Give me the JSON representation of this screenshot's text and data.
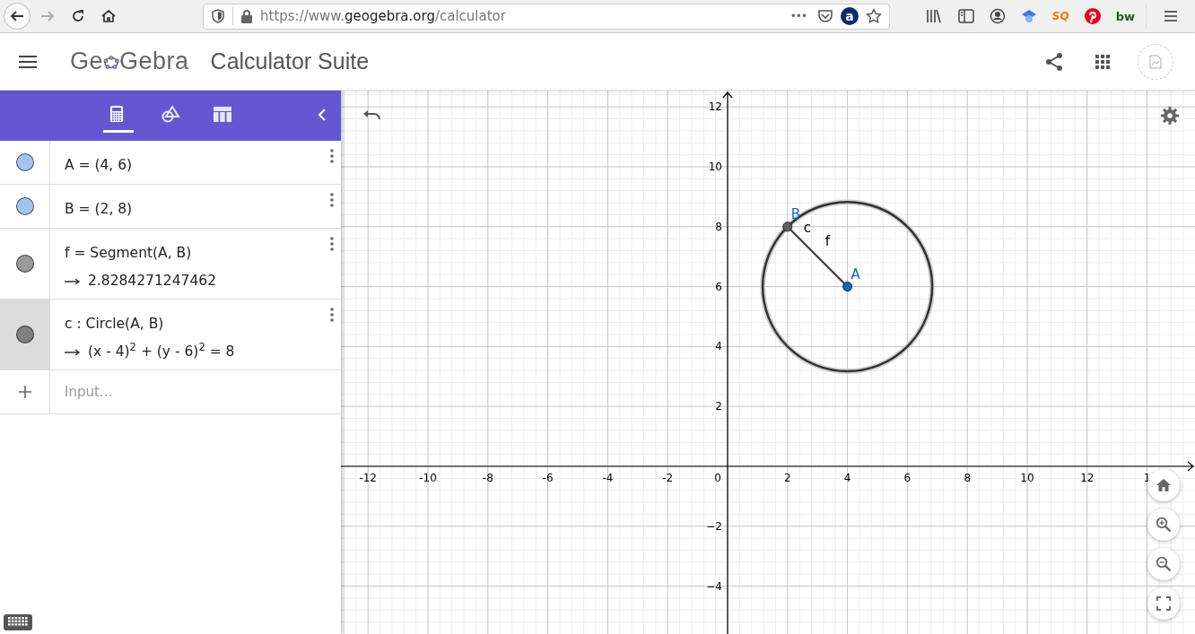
{
  "browser": {
    "nav": [
      {
        "kind": "back",
        "disabled": false
      },
      {
        "kind": "forward",
        "disabled": true
      },
      {
        "kind": "reload",
        "disabled": false
      },
      {
        "kind": "home",
        "disabled": false
      }
    ],
    "url": {
      "scheme": "https://www.",
      "domain": "geogebra.org",
      "path": "/calculator"
    },
    "url_actions": [
      {
        "kind": "more",
        "glyph": "•••"
      },
      {
        "kind": "pocket"
      },
      {
        "kind": "badge",
        "glyph": "a"
      },
      {
        "kind": "star"
      }
    ],
    "extensions": [
      {
        "kind": "library"
      },
      {
        "kind": "sidebar"
      },
      {
        "kind": "account"
      },
      {
        "kind": "cap"
      },
      {
        "kind": "badge",
        "glyph": "SQ"
      },
      {
        "kind": "pin"
      },
      {
        "kind": "word",
        "glyph": "bw"
      }
    ]
  },
  "app": {
    "logo": {
      "left": "Ge",
      "right": "Gebra"
    },
    "title": "Calculator Suite",
    "actions": [
      {
        "kind": "share"
      },
      {
        "kind": "apps"
      },
      {
        "kind": "avatar"
      }
    ]
  },
  "sidebar": {
    "tabs": [
      {
        "kind": "algebra",
        "selected": true
      },
      {
        "kind": "tools",
        "selected": false
      },
      {
        "kind": "table",
        "selected": false
      }
    ],
    "rows": [
      {
        "definition": "A = (4, 6)",
        "color": "#a3c4ec",
        "selected": false
      },
      {
        "definition": "B = (2, 8)",
        "color": "#a3c4ec",
        "selected": false
      },
      {
        "definition": "f = Segment(A, B)",
        "output": "2.8284271247462",
        "color": "#999999",
        "selected": false
      },
      {
        "definition": "c : Circle(A, B)",
        "output": "(x - 4)$^{2}$ + (y - 6)$^{2}$ = 8",
        "color": "#808080",
        "selected": true
      }
    ],
    "input": {
      "placeholder": "Input…"
    }
  },
  "graphics": {
    "x_ticks": [
      "-12",
      "-10",
      "-8",
      "-6",
      "-4",
      "-2",
      "0",
      "2",
      "4",
      "6",
      "8",
      "10",
      "12",
      "1"
    ],
    "y_ticks": [
      "12",
      "10",
      "8",
      "6",
      "4",
      "2",
      "−2",
      "−4"
    ],
    "points": [
      {
        "label": "A",
        "color": "#1565c0"
      },
      {
        "label": "B",
        "color": "#616161"
      }
    ],
    "segment_label": "f",
    "circle_label": "c",
    "controls": [
      {
        "kind": "home"
      },
      {
        "kind": "zoom-in"
      },
      {
        "kind": "zoom-out"
      },
      {
        "kind": "fullscreen"
      }
    ]
  }
}
